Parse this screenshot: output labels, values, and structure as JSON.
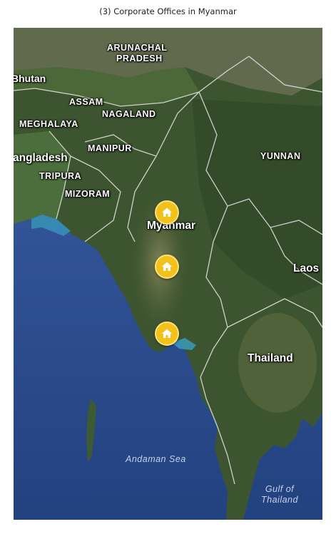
{
  "caption": "(3) Corporate Offices in Myanmar",
  "labels": {
    "arunachal_line1": "ARUNACHAL",
    "arunachal_line2": "PRADESH",
    "bhutan": "Bhutan",
    "assam": "ASSAM",
    "nagaland": "NAGALAND",
    "meghalaya": "MEGHALAYA",
    "bangladesh": "angladesh",
    "manipur": "MANIPUR",
    "tripura": "TRIPURA",
    "mizoram": "MIZORAM",
    "yunnan": "YUNNAN",
    "myanmar": "Myanmar",
    "laos": "Laos",
    "thailand": "Thailand",
    "andaman_sea": "Andaman Sea",
    "gulf_line1": "Gulf of",
    "gulf_line2": "Thailand"
  },
  "markers": [
    {
      "icon": "home-icon",
      "color": "#f2c21b"
    },
    {
      "icon": "home-icon",
      "color": "#f2c21b"
    },
    {
      "icon": "home-icon",
      "color": "#f2c21b"
    }
  ]
}
